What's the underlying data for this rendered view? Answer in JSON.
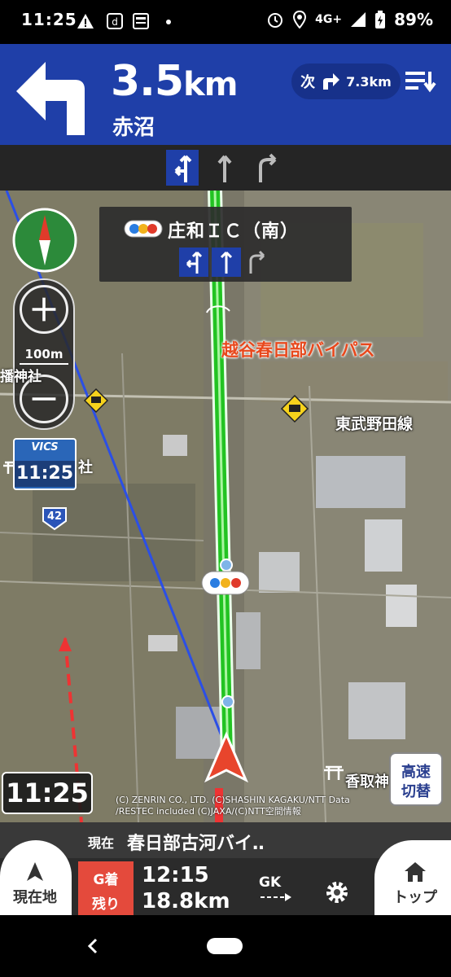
{
  "status_bar": {
    "time": "11:25",
    "network": "4G+",
    "battery": "89%"
  },
  "guidance": {
    "distance_value": "3.5",
    "distance_unit": "km",
    "place": "赤沼",
    "next_label": "次",
    "next_distance": "7.3km"
  },
  "intersection": {
    "title": "庄和ＩＣ（南）"
  },
  "map": {
    "scale": "100m",
    "vics_label": "VICS",
    "vics_time": "11:25",
    "road_name": "越谷春日部バイパス",
    "rail_name": "東武野田線",
    "shrine_name": "香取神",
    "shrine_left": "社",
    "shrine_left2": "播神社",
    "route_number": "42",
    "copyright_line1": "(C) ZENRIN CO., LTD. (C)SHASHIN KAGAKU/NTT Data",
    "copyright_line2": "/RESTEC included (C)JAXA/(C)NTT空間情報",
    "highway_btn_line1": "高速",
    "highway_btn_line2": "切替",
    "clock": "11:25"
  },
  "bottom": {
    "current_label": "現在",
    "current_road": "春日部古河バイ‥",
    "location_btn": "現在地",
    "eta_label": "G着",
    "eta_value": "12:15",
    "remaining_label": "残り",
    "remaining_value": "18.8km",
    "gk_label": "GK",
    "top_btn": "トップ"
  },
  "colors": {
    "guide_blue": "#1f3fa8",
    "route_green": "#22c322",
    "eta_red": "#e44a3c",
    "road_label": "#e8481c"
  }
}
